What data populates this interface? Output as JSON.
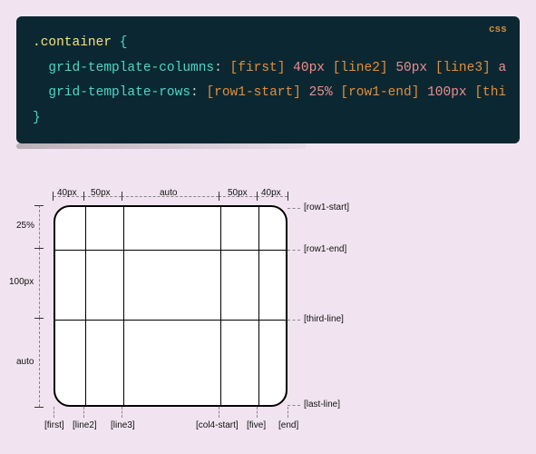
{
  "code": {
    "lang": "css",
    "selector": ".container",
    "open": "{",
    "close": "}",
    "lines": [
      {
        "prop": "grid-template-columns",
        "value_parts": [
          {
            "name": "[first]"
          },
          {
            "val": "40px"
          },
          {
            "name": "[line2]"
          },
          {
            "val": "50px"
          },
          {
            "name": "[line3]"
          },
          {
            "val": "a"
          }
        ]
      },
      {
        "prop": "grid-template-rows",
        "value_parts": [
          {
            "name": "[row1-start]"
          },
          {
            "val": "25%"
          },
          {
            "name": "[row1-end]"
          },
          {
            "val": "100px"
          },
          {
            "name": "[thi"
          }
        ]
      }
    ]
  },
  "diagram": {
    "col_sizes": [
      "40px",
      "50px",
      "auto",
      "50px",
      "40px"
    ],
    "row_sizes": [
      "25%",
      "100px",
      "auto"
    ],
    "col_names": [
      "[first]",
      "[line2]",
      "[line3]",
      "[col4-start]",
      "[five]",
      "[end]"
    ],
    "row_names": [
      "[row1-start]",
      "[row1-end]",
      "[third-line]",
      "[last-line]"
    ]
  },
  "chart_data": {
    "type": "table",
    "title": "CSS Grid template with named lines",
    "columns": {
      "line_names": [
        "first",
        "line2",
        "line3",
        "col4-start",
        "five",
        "end"
      ],
      "track_sizes": [
        "40px",
        "50px",
        "auto",
        "50px",
        "40px"
      ]
    },
    "rows": {
      "line_names": [
        "row1-start",
        "row1-end",
        "third-line",
        "last-line"
      ],
      "track_sizes": [
        "25%",
        "100px",
        "auto"
      ]
    }
  }
}
